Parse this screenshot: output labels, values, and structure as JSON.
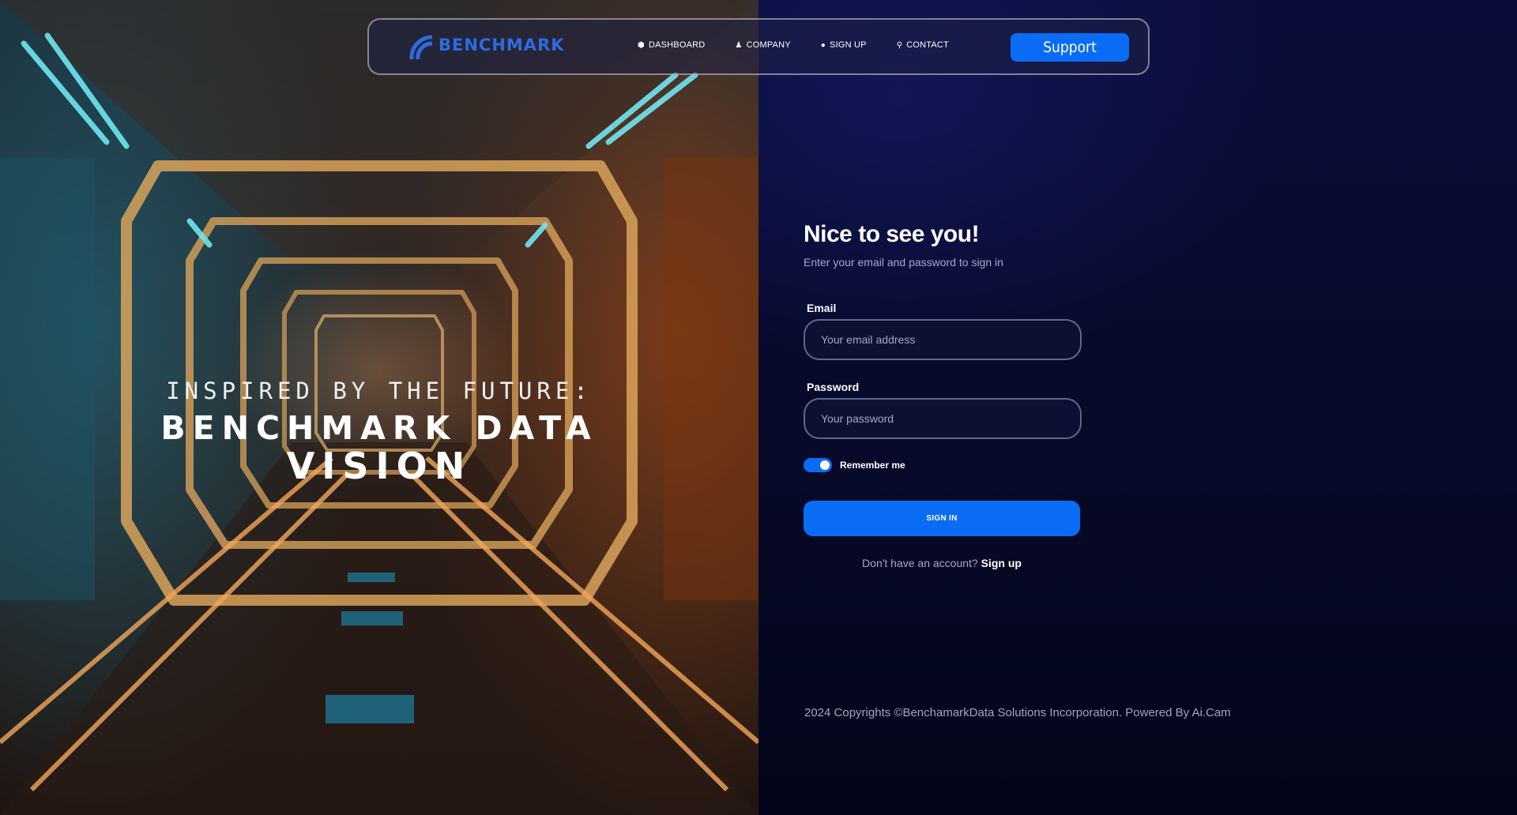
{
  "hero": {
    "line1": "INSPIRED BY THE FUTURE:",
    "line2": "BENCHMARK DATA",
    "line3": "VISION"
  },
  "navbar": {
    "logo_text": "BENCHMARK",
    "links": [
      {
        "icon": "cube-icon",
        "label": "DASHBOARD"
      },
      {
        "icon": "person-icon",
        "label": "COMPANY"
      },
      {
        "icon": "user-circle-icon",
        "label": "SIGN UP"
      },
      {
        "icon": "key-icon",
        "label": "CONTACT"
      }
    ],
    "support_label": "Support"
  },
  "form": {
    "title": "Nice to see you!",
    "subtitle": "Enter your email and password to sign in",
    "email_label": "Email",
    "email_placeholder": "Your email address",
    "email_value": "",
    "password_label": "Password",
    "password_placeholder": "Your password",
    "password_value": "",
    "remember_label": "Remember me",
    "remember_checked": true,
    "signin_label": "SIGN IN",
    "no_account_text": "Don't have an account?",
    "signup_link": "Sign up"
  },
  "footer": {
    "text": "2024 Copyrights ©BenchamarkData Solutions Incorporation. Powered By Ai.Cam"
  },
  "colors": {
    "accent": "#0a6cf5",
    "panel_bg": "#070a2a",
    "muted_text": "#a4a9c8"
  }
}
